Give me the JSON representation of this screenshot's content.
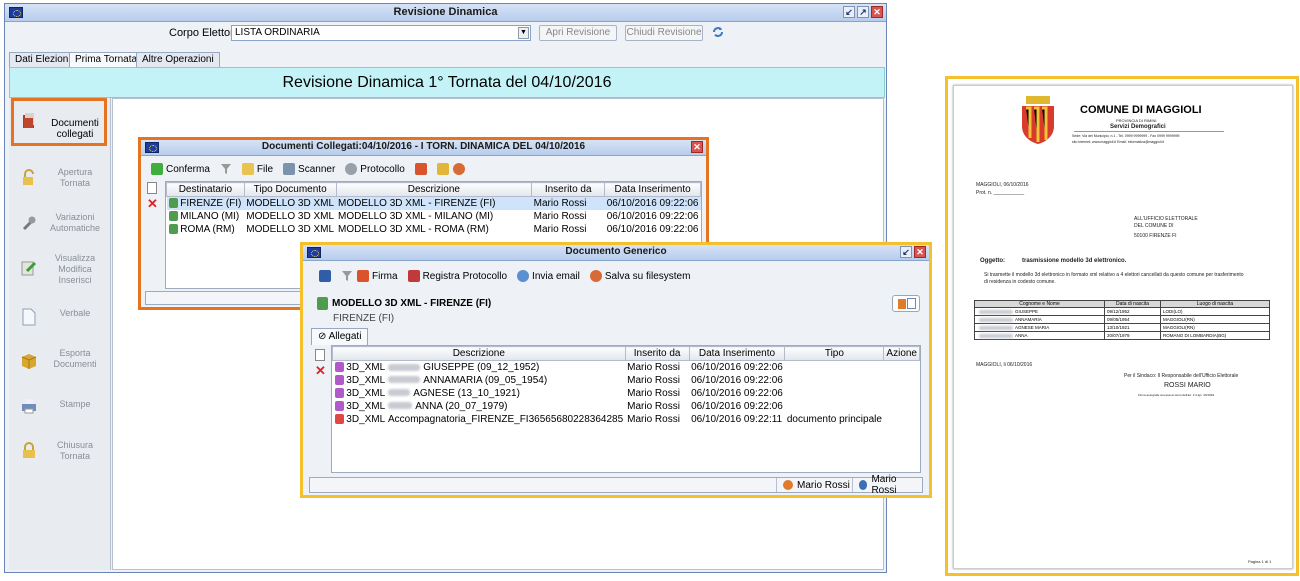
{
  "main_window": {
    "title": "Revisione Dinamica",
    "corpo_label": "Corpo Elettorale",
    "corpo_value": "LISTA ORDINARIA",
    "apri_button": "Apri Revisione",
    "chiudi_button": "Chiudi Revisione",
    "tabs": [
      {
        "label": "Dati Elezioni"
      },
      {
        "label": "Prima Tornata"
      },
      {
        "label": "Altre Operazioni"
      }
    ],
    "banner": "Revisione Dinamica  1° Tornata del 04/10/2016"
  },
  "sidebar": {
    "items": [
      {
        "label": "Documenti collegati",
        "icon": "documents-icon"
      },
      {
        "label": "Apertura Tornata",
        "icon": "unlock-icon"
      },
      {
        "label": "Variazioni Automatiche",
        "icon": "wrench-icon"
      },
      {
        "label": "Visualizza Modifica Inserisci",
        "icon": "edit-icon"
      },
      {
        "label": "Verbale",
        "icon": "page-icon"
      },
      {
        "label": "Esporta Documenti",
        "icon": "box-icon"
      },
      {
        "label": "Stampe",
        "icon": "printer-icon"
      },
      {
        "label": "Chiusura Tornata",
        "icon": "lock-icon"
      }
    ]
  },
  "dialog_collegati": {
    "title": "Documenti Collegati:04/10/2016 - I TORN. DINAMICA DEL 04/10/2016",
    "toolbar": {
      "conferma": "Conferma",
      "file": "File",
      "scanner": "Scanner",
      "protocollo": "Protocollo"
    },
    "columns": [
      "Destinatario",
      "Tipo Documento",
      "Descrizione",
      "Inserito da",
      "Data Inserimento"
    ],
    "rows": [
      [
        "FIRENZE (FI)",
        "MODELLO 3D XML",
        "MODELLO 3D XML - FIRENZE (FI)",
        "Mario Rossi",
        "06/10/2016 09:22:06"
      ],
      [
        "MILANO (MI)",
        "MODELLO 3D XML",
        "MODELLO 3D XML - MILANO (MI)",
        "Mario Rossi",
        "06/10/2016 09:22:06"
      ],
      [
        "ROMA (RM)",
        "MODELLO 3D XML",
        "MODELLO 3D XML - ROMA (RM)",
        "Mario Rossi",
        "06/10/2016 09:22:06"
      ]
    ]
  },
  "dialog_generico": {
    "title": "Documento Generico",
    "toolbar": {
      "firma": "Firma",
      "registra": "Registra Protocollo",
      "email": "Invia email",
      "salva": "Salva su filesystem"
    },
    "doc_title": "MODELLO 3D XML - FIRENZE (FI)",
    "doc_subtitle": "FIRENZE (FI)",
    "tab_allegati": "Allegati",
    "columns": [
      "Descrizione",
      "Inserito da",
      "Data Inserimento",
      "Tipo",
      "Azione"
    ],
    "rows": [
      {
        "pre": "3D_XML",
        "post": "GIUSEPPE (09_12_1952)",
        "by": "Mario Rossi",
        "date": "06/10/2016 09:22:06",
        "tipo": "",
        "icon": "xml-icon"
      },
      {
        "pre": "3D_XML",
        "post": "ANNAMARIA (09_05_1954)",
        "by": "Mario Rossi",
        "date": "06/10/2016 09:22:06",
        "tipo": "",
        "icon": "xml-icon"
      },
      {
        "pre": "3D_XML",
        "post": "AGNESE (13_10_1921)",
        "by": "Mario Rossi",
        "date": "06/10/2016 09:22:06",
        "tipo": "",
        "icon": "xml-icon"
      },
      {
        "pre": "3D_XML",
        "post": "ANNA (20_07_1979)",
        "by": "Mario Rossi",
        "date": "06/10/2016 09:22:06",
        "tipo": "",
        "icon": "xml-icon"
      },
      {
        "pre": "3D_XML",
        "post": "Accompagnatoria_FIRENZE_FI36565680228364285",
        "by": "Mario Rossi",
        "date": "06/10/2016 09:22:11",
        "tipo": "documento principale",
        "icon": "pdf-icon"
      }
    ],
    "status_user1": "Mario Rossi",
    "status_user2": "Mario Rossi"
  },
  "letter": {
    "comune": "COMUNE DI MAGGIOLI",
    "provincia": "PROVINCIA DI RIMINI",
    "servizi": "Servizi Demografici",
    "address1": "Sede: Via del Municipio, n.1 - Tel. 0999 9999999 - Fax 0999 9999999",
    "address2": "sito internet: www.maggioli.it    Email: informatica@maggioli.it",
    "date_line": "MAGGIOLI, 06/10/2016",
    "prot": "Prot. n. ___________",
    "to1": "ALL'UFFICIO ELETTORALE",
    "to2": "DEL COMUNE DI",
    "to3": "50100 FIRENZE FI",
    "oggetto_label": "Oggetto:",
    "oggetto_text": "trasmissione modello 3d elettronico.",
    "body": "Si trasmette il modello 3d elettronico in formato xml relativo a 4 elettori cancellati da questo comune per trasferimento di residenza in codesto comune.",
    "table_headers": [
      "Cognome e Nome",
      "Data di nascita",
      "Luogo di nascita"
    ],
    "table_rows": [
      [
        "GIUSEPPE",
        "09/12/1952",
        "LODI(LO)"
      ],
      [
        "ANNAMARIA",
        "09/05/1954",
        "MAGGIOLI(RN)"
      ],
      [
        "AGNESE MARIA",
        "13/10/1921",
        "MAGGIOLI(RN)"
      ],
      [
        "ANNA",
        "20/07/1979",
        "ROMANO DI LOMBARDIA(BG)"
      ]
    ],
    "closing_date": "MAGGIOLI, li 06/10/2016",
    "signer_role": "Per il Sindaco: Il Responsabile dell'Ufficio Elettorale",
    "signer_name": "ROSSI MARIO",
    "signer_note": "Firma autografa omessa ai sensi dell'art. 3 d.lgs. 39/1993",
    "page": "Pagina 1 di 1"
  },
  "colors": {
    "orange_highlight": "#e6731f",
    "yellow_highlight": "#f4c12c",
    "banner": "#c3f2f7",
    "titlebar": "#c6d7f0"
  }
}
